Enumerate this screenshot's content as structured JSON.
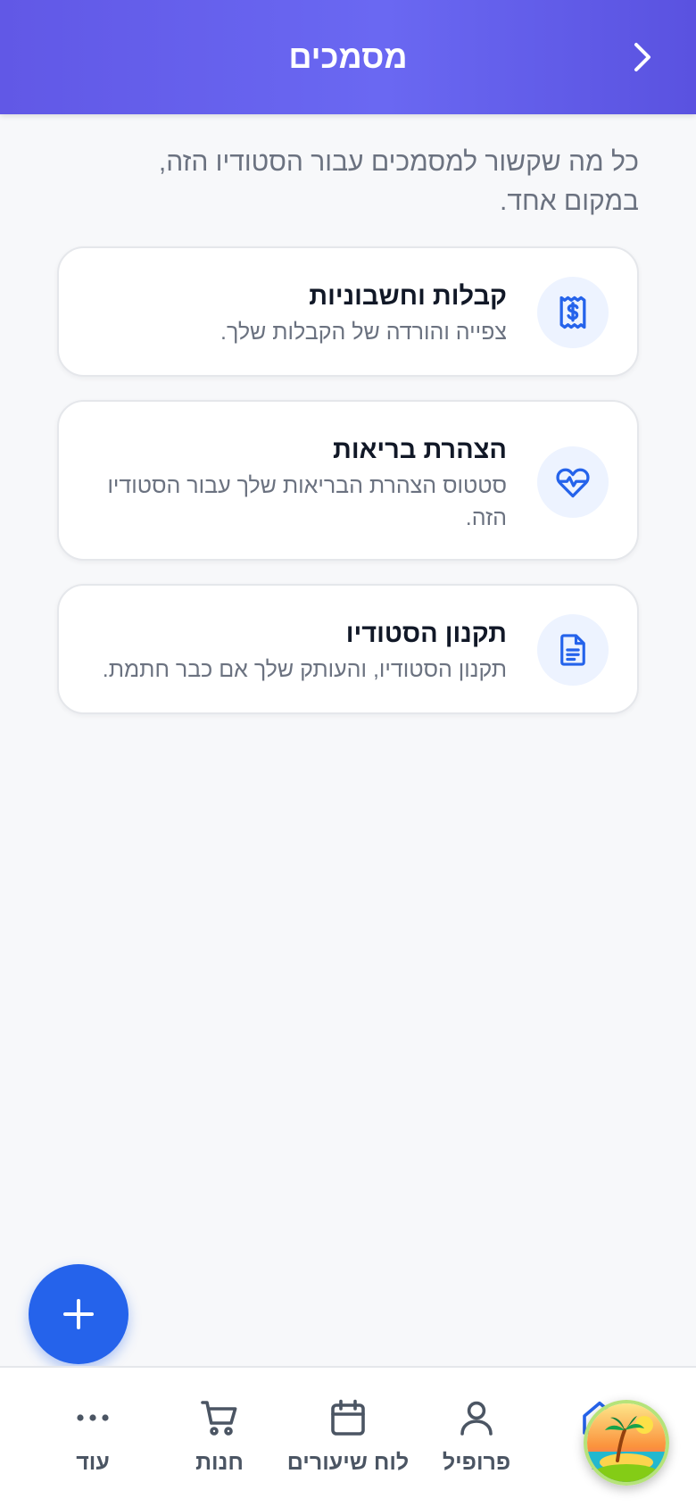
{
  "header": {
    "title": "מסמכים",
    "back_icon": "chevron-right-icon"
  },
  "intro": "כל מה שקשור למסמכים עבור הסטודיו הזה, במקום אחד.",
  "cards": [
    {
      "title": "קבלות וחשבוניות",
      "description": "צפייה והורדה של הקבלות שלך.",
      "icon": "receipt-dollar-icon"
    },
    {
      "title": "הצהרת בריאות",
      "description": "סטטוס הצהרת הבריאות שלך עבור הסטודיו הזה.",
      "icon": "heart-pulse-icon"
    },
    {
      "title": "תקנון הסטודיו",
      "description": "תקנון הסטודיו, והעותק שלך אם כבר חתמת.",
      "icon": "document-icon"
    }
  ],
  "fab": {
    "icon": "plus-icon"
  },
  "bottom_nav": {
    "items": [
      {
        "label": "ת",
        "icon": "home-icon"
      },
      {
        "label": "פרופיל",
        "icon": "user-icon"
      },
      {
        "label": "לוח שיעורים",
        "icon": "calendar-icon"
      },
      {
        "label": "חנות",
        "icon": "cart-icon"
      },
      {
        "label": "עוד",
        "icon": "more-icon"
      }
    ]
  },
  "colors": {
    "header_start": "#6158e6",
    "header_end": "#5a52e0",
    "accent": "#2563eb",
    "icon_bg": "#edf3ff"
  }
}
